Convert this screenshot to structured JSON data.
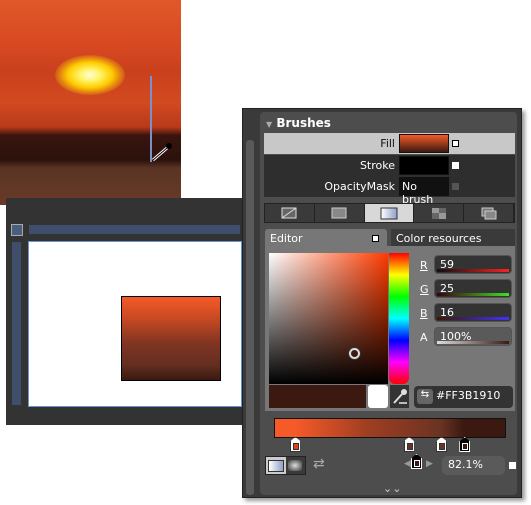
{
  "brushes": {
    "title": "Brushes",
    "rows": [
      {
        "label": "Fill",
        "value": ""
      },
      {
        "label": "Stroke",
        "value": ""
      },
      {
        "label": "OpacityMask",
        "value": "No brush"
      }
    ]
  },
  "brush_types": [
    "no-brush-icon",
    "solid-color-brush-icon",
    "gradient-brush-icon",
    "tile-brush-icon",
    "brush-resources-icon"
  ],
  "editor": {
    "tab_editor": "Editor",
    "tab_resources": "Color resources",
    "channels": [
      {
        "label": "R",
        "value": "59",
        "color": "#ff2020"
      },
      {
        "label": "G",
        "value": "25",
        "color": "#40e020"
      },
      {
        "label": "B",
        "value": "16",
        "color": "#4030ff"
      },
      {
        "label": "A",
        "value": "100%",
        "color": "#c0c0c0"
      }
    ],
    "hex": "#FF3B1910",
    "current_color": "#3b1910"
  },
  "gradient": {
    "stops": [
      {
        "offset": 0.09,
        "color": "#e0401a"
      },
      {
        "offset": 0.58,
        "color": "#6a3322"
      },
      {
        "offset": 0.72,
        "color": "#6a3322"
      },
      {
        "offset": 0.82,
        "color": "#3b1910",
        "selected": true
      }
    ],
    "selected_offset": "82.1%"
  },
  "colors": {
    "accent": "#f55a28",
    "dark": "#3b1910"
  }
}
